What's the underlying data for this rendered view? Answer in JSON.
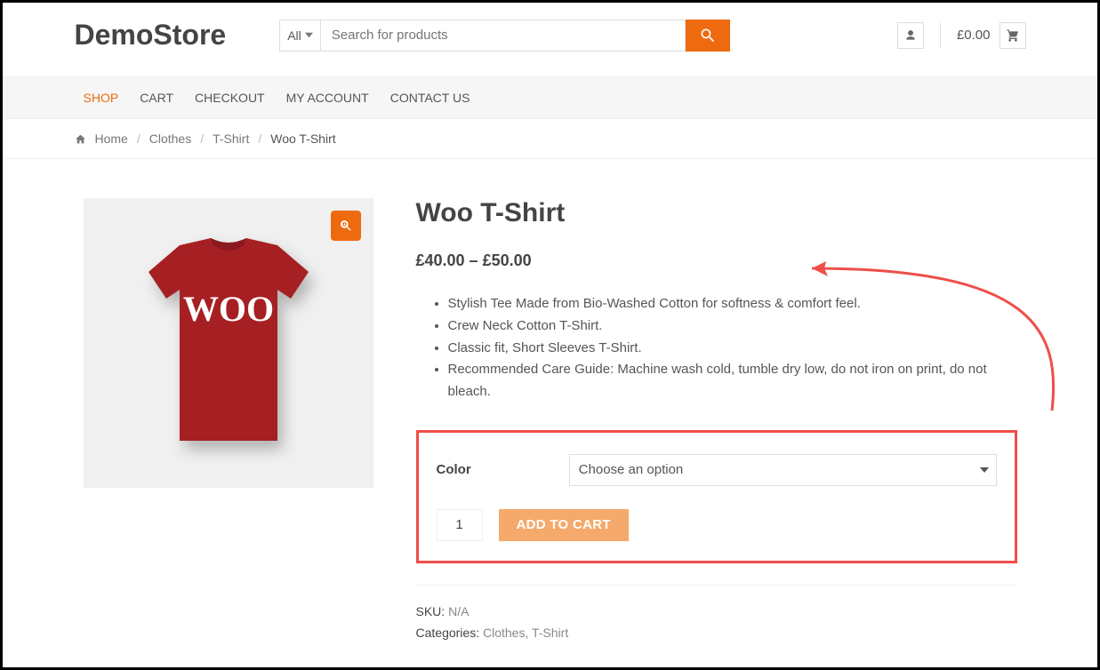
{
  "header": {
    "logo": "DemoStore",
    "search": {
      "category": "All",
      "placeholder": "Search for products"
    },
    "cart_total": "£0.00"
  },
  "nav": {
    "items": [
      "SHOP",
      "CART",
      "CHECKOUT",
      "MY ACCOUNT",
      "CONTACT US"
    ],
    "active_index": 0
  },
  "breadcrumb": {
    "items": [
      "Home",
      "Clothes",
      "T-Shirt"
    ],
    "current": "Woo T-Shirt"
  },
  "product": {
    "title": "Woo T-Shirt",
    "price": "£40.00 – £50.00",
    "image_text": "WOO",
    "bullets": [
      "Stylish Tee Made from Bio-Washed Cotton for softness & comfort feel.",
      "Crew Neck Cotton T-Shirt.",
      "Classic fit, Short Sleeves T-Shirt.",
      "Recommended Care Guide: Machine wash cold, tumble dry low, do not iron on print, do not bleach."
    ],
    "variation": {
      "label": "Color",
      "placeholder": "Choose an option"
    },
    "qty": "1",
    "add_to_cart": "ADD TO CART",
    "meta": {
      "sku_label": "SKU: ",
      "sku_value": "N/A",
      "cat_label": "Categories: ",
      "cat_value": "Clothes, T-Shirt"
    }
  },
  "colors": {
    "accent": "#ed6a0f",
    "annotation": "#ee4f4a"
  }
}
